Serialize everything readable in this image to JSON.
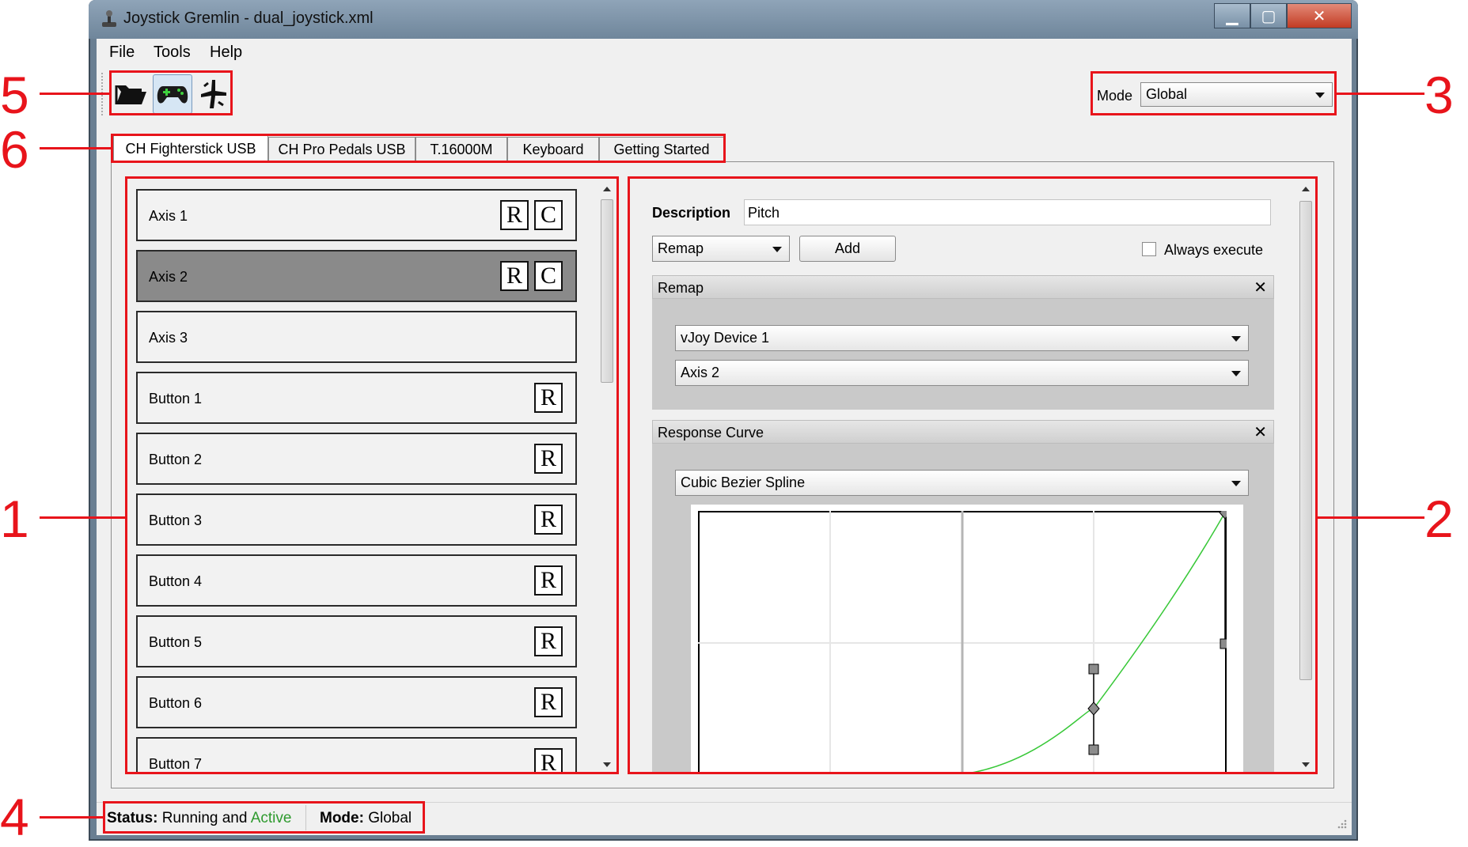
{
  "window": {
    "title": "Joystick Gremlin - dual_joystick.xml"
  },
  "menu": [
    "File",
    "Tools",
    "Help"
  ],
  "toolbar": {
    "buttons": [
      {
        "icon": "open-folder-icon"
      },
      {
        "icon": "gamepad-icon"
      },
      {
        "icon": "joystick-icon"
      }
    ]
  },
  "mode": {
    "label": "Mode",
    "value": "Global"
  },
  "tabs": [
    "CH Fighterstick USB",
    "CH Pro Pedals USB",
    "T.16000M",
    "Keyboard",
    "Getting Started"
  ],
  "inputs": [
    {
      "label": "Axis 1",
      "badges": [
        "R",
        "C"
      ]
    },
    {
      "label": "Axis 2",
      "badges": [
        "R",
        "C"
      ],
      "selected": true
    },
    {
      "label": "Axis 3",
      "badges": []
    },
    {
      "label": "Button 1",
      "badges": [
        "R"
      ]
    },
    {
      "label": "Button 2",
      "badges": [
        "R"
      ]
    },
    {
      "label": "Button 3",
      "badges": [
        "R"
      ]
    },
    {
      "label": "Button 4",
      "badges": [
        "R"
      ]
    },
    {
      "label": "Button 5",
      "badges": [
        "R"
      ]
    },
    {
      "label": "Button 6",
      "badges": [
        "R"
      ]
    },
    {
      "label": "Button 7",
      "badges": [
        "R"
      ]
    }
  ],
  "editor": {
    "description_label": "Description",
    "description_value": "Pitch",
    "action_select": "Remap",
    "add_label": "Add",
    "always_execute_label": "Always execute",
    "remap": {
      "title": "Remap",
      "device": "vJoy Device 1",
      "axis": "Axis 2"
    },
    "response_curve": {
      "title": "Response Curve",
      "curve_type": "Cubic Bezier Spline"
    }
  },
  "status": {
    "status_label": "Status:",
    "status_text": "Running and",
    "status_active": "Active",
    "mode_label": "Mode:",
    "mode_value": "Global",
    "active_color": "#2e9a2e"
  },
  "annotations": [
    "1",
    "2",
    "3",
    "4",
    "5",
    "6"
  ],
  "colors": {
    "annotation": "#e8141b",
    "curve": "#38c838",
    "selected_row": "#8a8a8a"
  },
  "close_glyph": "✕"
}
